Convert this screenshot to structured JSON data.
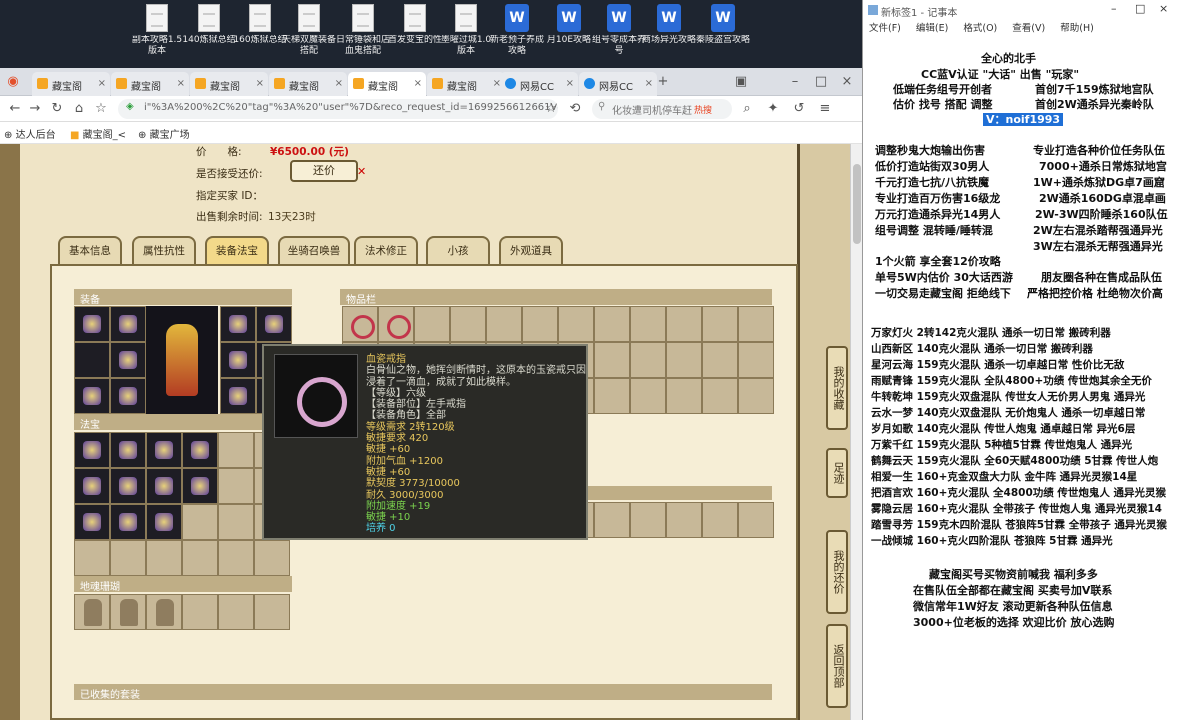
{
  "desktop": {
    "icons": [
      {
        "label": "副本攻略1.5版本",
        "type": "doc"
      },
      {
        "label": "140炼狱总结",
        "type": "doc"
      },
      {
        "label": "160炼狱总结",
        "type": "doc"
      },
      {
        "label": "天梯双魔装备搭配",
        "type": "doc"
      },
      {
        "label": "日常锤袋和店血鬼搭配",
        "type": "doc"
      },
      {
        "label": "首发变宝的性",
        "type": "doc"
      },
      {
        "label": "墨曜过城1.0版本",
        "type": "doc"
      },
      {
        "label": "新老预子养成攻略",
        "type": "word"
      },
      {
        "label": "月10E攻略",
        "type": "word"
      },
      {
        "label": "组号零成本养号",
        "type": "word"
      },
      {
        "label": "商场异光攻略",
        "type": "word"
      },
      {
        "label": "秦陵盗宫攻略",
        "type": "word"
      }
    ]
  },
  "browser": {
    "tabs": [
      {
        "label": "藏宝阁",
        "active": false,
        "icon": "bag-icon"
      },
      {
        "label": "藏宝阁",
        "active": false,
        "icon": "bag-icon"
      },
      {
        "label": "藏宝阁",
        "active": false,
        "icon": "bag-icon"
      },
      {
        "label": "藏宝阁",
        "active": false,
        "icon": "bag-icon"
      },
      {
        "label": "藏宝阁",
        "active": true,
        "icon": "bag-icon"
      },
      {
        "label": "藏宝阁",
        "active": false,
        "icon": "bag-icon"
      },
      {
        "label": "网易CC",
        "active": false,
        "icon": "cc-icon"
      },
      {
        "label": "网易CC",
        "active": false,
        "icon": "cc-icon"
      }
    ],
    "url": "i\"%3A%200%2C%20\"tag\"%3A%20\"user\"%7D&reco_request_id=1699256612661V49hM",
    "search_placeholder": "化妆遭司机停车赶",
    "hot_label": "热搜",
    "bookmarks": [
      "达人后台",
      "藏宝阁_<",
      "藏宝广场"
    ]
  },
  "listing": {
    "price_label": "价　　格:",
    "price_value": "¥6500.00 (元)",
    "counter_label": "是否接受还价:",
    "counter_button": "还价",
    "buyer_label": "指定买家 ID：",
    "remaining_label": "出售剩余时间:",
    "remaining_value": "13天23时"
  },
  "game_tabs": [
    {
      "label": "基本信息",
      "active": false
    },
    {
      "label": "属性抗性",
      "active": false
    },
    {
      "label": "装备法宝",
      "active": true
    },
    {
      "label": "坐骑召唤兽",
      "active": false
    },
    {
      "label": "法术修正",
      "active": false
    },
    {
      "label": "小孩",
      "active": false
    },
    {
      "label": "外观道具",
      "active": false
    }
  ],
  "sections": {
    "equip": "装备",
    "items": "物品栏",
    "treasure": "法宝",
    "pets": "地魂珊瑚",
    "collected": "已收集的套装"
  },
  "tooltip": {
    "name": "血瓷戒指",
    "desc": "白骨仙之物，她挥剑断情时，这原本的玉瓷戒只因浸着了一滴血，成就了如此模样。",
    "lines": [
      {
        "text": "【等级】六级",
        "cls": "tplain"
      },
      {
        "text": "【装备部位】左手戒指",
        "cls": "tplain"
      },
      {
        "text": "【装备角色】全部",
        "cls": "tplain"
      },
      {
        "text": "等级需求 2转120级",
        "cls": "tname"
      },
      {
        "text": "敏捷要求 420",
        "cls": "tname"
      },
      {
        "text": "敏捷 +60",
        "cls": "tname"
      },
      {
        "text": "附加气血 +1200",
        "cls": "tname"
      },
      {
        "text": "敏捷 +60",
        "cls": "tname"
      },
      {
        "text": "默契度 3773/10000",
        "cls": "tname"
      },
      {
        "text": "耐久 3000/3000",
        "cls": "tname"
      },
      {
        "text": "附加速度 +19",
        "cls": "tgreen"
      },
      {
        "text": "敏捷 +10",
        "cls": "tgreen"
      },
      {
        "text": "培养 0",
        "cls": "tcyan"
      }
    ]
  },
  "side_buttons": [
    "我的收藏",
    "足迹",
    "我的还价",
    "返回顶部"
  ],
  "notepad": {
    "title": "新标签1 - 记事本",
    "menu": [
      "文件(F)",
      "编辑(E)",
      "格式(O)",
      "查看(V)",
      "帮助(H)"
    ],
    "header": [
      "全心的北手",
      "CC蓝V认证 \"大话\" 出售 \"玩家\"",
      "低端任务组号开创者",
      "首创7千159炼狱地宫队",
      "估价 找号 搭配 调整",
      "首创2W通杀异光秦岭队"
    ],
    "vid": "V：noif1993",
    "services_left": [
      "调整秒鬼大炮输出伤害",
      "低价打造站街双30男人",
      "千元打造七抗/八抗铁魔",
      "专业打造百万伤害16级龙",
      "万元打造通杀异光14男人",
      "组号调整 混转睡/睡转混"
    ],
    "services_right": [
      "专业打造各种价位任务队伍",
      "7000+通杀日常炼狱地宫",
      "1W+通杀炼狱DG卓7画窟",
      "2W通杀160DG卓混卓画",
      "2W-3W四阶睡杀160队伍",
      "2W左右混杀踏帮强通异光",
      "3W左右混杀无帮强通异光"
    ],
    "promo": [
      "1个火箭 享全套12价攻略",
      "单号5W内估价 30大话西游",
      "朋友圈各种在售成品队伍",
      "一切交易走藏宝阁 拒绝线下",
      "严格把控价格 杜绝物次价高"
    ],
    "teams": [
      "万家灯火 2转142克火混队 通杀一切日常 搬砖利器",
      "山西新区 140克火混队 通杀一切日常 搬砖利器",
      "星河云海 159克火混队 通杀一切卓越日常 性价比无敌",
      "雨赋青锋 159克火混队 全队4800+功绩 传世炮其余全无价",
      "牛转乾坤 159克火双盘混队 传世女人无价男人男鬼 通异光",
      "云水一梦 140克火双盘混队 无价炮鬼人 通杀一切卓越日常",
      "岁月如歌 140克火混队 传世人炮鬼 通卓越日常 异光6层",
      "万紫千红 159克火混队 5种植5甘霖 传世炮鬼人 通异光",
      "鹤舞云天 159克火混队 全60天赋4800功绩 5甘霖 传世人炮",
      "相爱一生 160+克金双盘大力队 金牛阵 通异光灵猴14星",
      "把酒言欢 160+克火混队 全4800功绩 传世炮鬼人 通异光灵猴",
      "雾隐云居 160+克火混队 全带孩子 传世炮人鬼 通异光灵猴14",
      "踏雪寻芳 159克木四阶混队 苍狼阵5甘霖 全带孩子 通异光灵猴",
      "一战倾城 160+克火四阶混队 苍狼阵 5甘霖 通异光"
    ],
    "footer": [
      "藏宝阁买号买物资前喊我 福利多多",
      "在售队伍全部都在藏宝阁 买卖号加V联系",
      "微信常年1W好友 滚动更新各种队伍信息",
      "3000+位老板的选择 欢迎比价 放心选购"
    ]
  }
}
